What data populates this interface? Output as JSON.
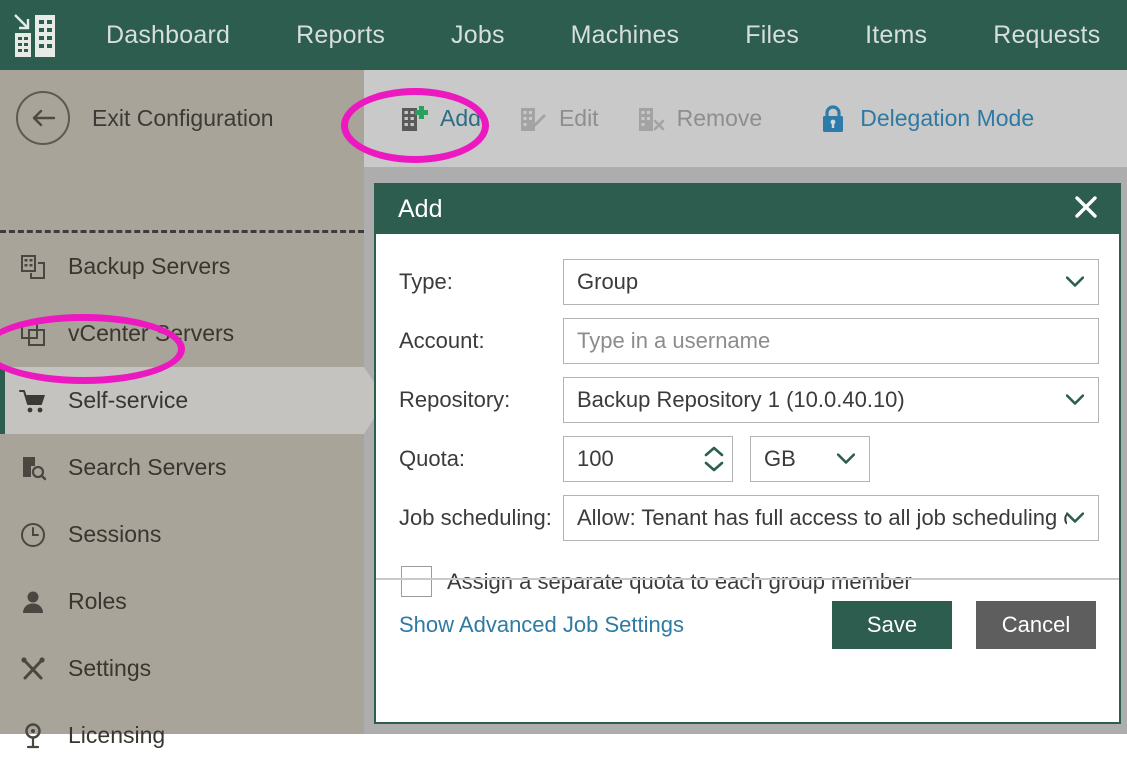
{
  "app": {
    "logo_icon": "datacenter-building-icon",
    "brand_color": "#2c5d4f",
    "annotation_color": "#ec19c0"
  },
  "topnav": {
    "items": [
      {
        "label": "Dashboard",
        "icon": "none"
      },
      {
        "label": "Reports",
        "icon": "none"
      },
      {
        "label": "Jobs",
        "icon": "none"
      },
      {
        "label": "Machines",
        "icon": "none"
      },
      {
        "label": "Files",
        "icon": "none"
      },
      {
        "label": "Items",
        "icon": "none"
      },
      {
        "label": "Requests",
        "icon": "none"
      }
    ]
  },
  "sidebar": {
    "exit_label": "Exit Configuration",
    "exit_icon": "back-arrow-circle-icon",
    "items": [
      {
        "label": "Backup Servers",
        "icon": "backup-server-icon",
        "selected": false
      },
      {
        "label": "vCenter Servers",
        "icon": "vcenter-server-icon",
        "selected": false
      },
      {
        "label": "Self-service",
        "icon": "shopping-cart-icon",
        "selected": true
      },
      {
        "label": "Search Servers",
        "icon": "search-server-icon",
        "selected": false
      },
      {
        "label": "Sessions",
        "icon": "clock-icon",
        "selected": false
      },
      {
        "label": "Roles",
        "icon": "user-icon",
        "selected": false
      },
      {
        "label": "Settings",
        "icon": "tools-icon",
        "selected": false
      },
      {
        "label": "Licensing",
        "icon": "award-medal-icon",
        "selected": false
      }
    ]
  },
  "toolbar": {
    "add_label": "Add",
    "add_icon": "building-plus-icon",
    "edit_label": "Edit",
    "edit_icon": "building-pencil-icon",
    "remove_label": "Remove",
    "remove_icon": "building-remove-icon",
    "delegation_label": "Delegation Mode",
    "delegation_icon": "lock-icon"
  },
  "dialog": {
    "title": "Add",
    "close_icon": "close-icon",
    "fields": {
      "type": {
        "label": "Type:",
        "value": "Group",
        "control": "dropdown"
      },
      "account": {
        "label": "Account:",
        "value": "",
        "placeholder": "Type in a username",
        "control": "textbox"
      },
      "repository": {
        "label": "Repository:",
        "value": "Backup Repository 1 (10.0.40.10)",
        "control": "dropdown"
      },
      "quota": {
        "label": "Quota:",
        "value": "100",
        "control": "spinner",
        "unit_value": "GB",
        "unit_control": "dropdown"
      },
      "job_scheduling": {
        "label": "Job scheduling:",
        "value": "Allow: Tenant has full access to all job scheduling o",
        "control": "dropdown"
      }
    },
    "checkbox": {
      "label": "Assign a separate quota to each group member",
      "checked": false
    },
    "footer": {
      "advanced_link": "Show Advanced Job Settings",
      "save_label": "Save",
      "cancel_label": "Cancel"
    }
  },
  "annotations": [
    {
      "name": "add-button-highlight",
      "shape": "ellipse"
    },
    {
      "name": "self-service-highlight",
      "shape": "ellipse"
    }
  ]
}
